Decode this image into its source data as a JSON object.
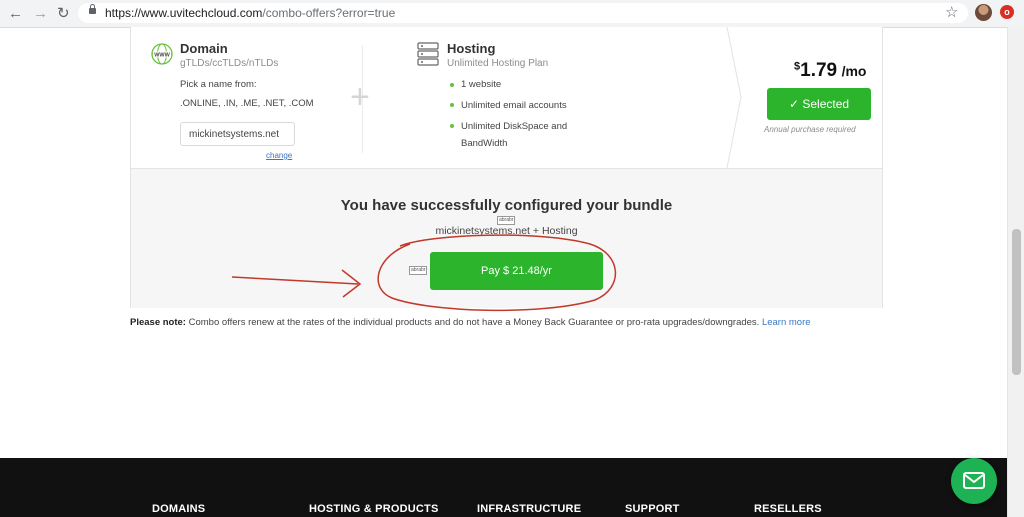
{
  "browser": {
    "back_icon": "back-arrow-icon",
    "forward_icon": "forward-arrow-icon",
    "reload_icon": "reload-icon",
    "url_host": "https://www.uvitechcloud.com",
    "url_path": "/combo-offers?error=true",
    "bookmark_icon": "star-icon",
    "extension_badge": "o"
  },
  "domain": {
    "title": "Domain",
    "subtitle": "gTLDs/ccTLDs/nTLDs",
    "pick_label": "Pick a name from:",
    "extensions": ".ONLINE, .IN, .ME, .NET, .COM",
    "input_value": "mickinetsystems.net",
    "change_link": "change",
    "icon": "www-globe-icon"
  },
  "hosting": {
    "title": "Hosting",
    "subtitle": "Unlimited Hosting Plan",
    "icon": "server-icon",
    "features": [
      "1 website",
      "Unlimited email accounts",
      "Unlimited DiskSpace and",
      "BandWidth"
    ]
  },
  "pricing": {
    "currency": "$",
    "amount": "1.79",
    "period": "/mo",
    "selected_label": "Selected",
    "annual_note": "Annual purchase required"
  },
  "bundle": {
    "success_message": "You have successfully configured your bundle",
    "summary": "mickinetsystems.net + Hosting",
    "pay_label": "Pay $ 21.48/yr",
    "tag_text": "abrabr"
  },
  "note": {
    "label": "Please note:",
    "text": " Combo offers renew at the rates of the individual products and do not have a Money Back Guarantee or pro-rata upgrades/downgrades.",
    "link": "Learn more"
  },
  "footer": {
    "columns": [
      "DOMAINS",
      "HOSTING & PRODUCTS",
      "INFRASTRUCTURE",
      "SUPPORT",
      "RESELLERS"
    ]
  },
  "chat_button_icon": "envelope-icon",
  "colors": {
    "accent_green": "#2cb52c",
    "link_blue": "#3b78c2",
    "annotation_red": "#c0392b",
    "footer_bg": "#111111"
  }
}
